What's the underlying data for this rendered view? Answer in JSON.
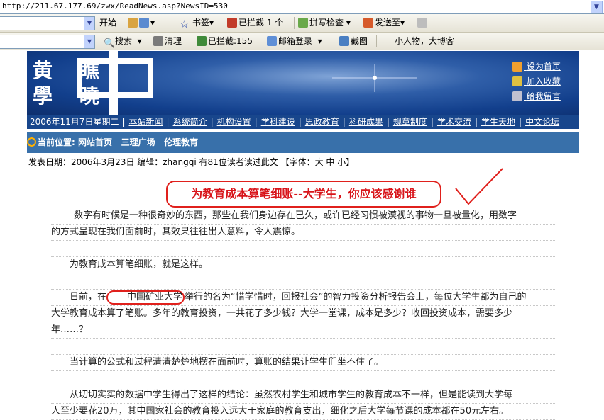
{
  "address": {
    "url": "http://211.67.177.69/zwx/ReadNews.asp?NewsID=530"
  },
  "toolbar1": {
    "start_label": "开始",
    "bookmarks_label": "书签",
    "blocked_label": "已拦截 1 个",
    "spellcheck_label": "拼写检查",
    "sendto_label": "发送至"
  },
  "toolbar2": {
    "search_label": "搜索",
    "clean_label": "清理",
    "blocked_label": "已拦截:155",
    "mail_label": "邮箱登录",
    "screenshot_label": "截图",
    "slogan": "小人物，大博客"
  },
  "banner": {
    "logo_line1": "黄 瞧",
    "logo_line2": "學 曉",
    "links": [
      "设为首页",
      "加入收藏",
      "给我留言"
    ]
  },
  "nav": {
    "date": "2006年11月7日星期二",
    "items": [
      "本站新闻",
      "系统简介",
      "机构设置",
      "学科建设",
      "思政教育",
      "科研成果",
      "规章制度",
      "学术交流",
      "学生天地",
      "中文论坛"
    ]
  },
  "breadcrumb": {
    "label": "当前位置:",
    "items": [
      "网站首页",
      "三理广场",
      "伦理教育"
    ]
  },
  "meta": {
    "text": "发表日期：2006年3月23日 编辑：zhangqi 有81位读者读过此文 【字体：大 中 小】"
  },
  "article": {
    "title": "为教育成本算笔细账--大学生，你应该感谢谁",
    "p1a": "数字有时候是一种很奇妙的东西，那些在我们身边存在已久，或许已经习惯被漠视的事物一旦被量化，用数字",
    "p1b": "的方式呈现在我们面前时，其效果往往出人意料，令人震惊。",
    "p2": "为教育成本算笔细账，就是这样。",
    "p3a_pre": "日前，在",
    "p3a_circ": "中国矿业大学",
    "p3a_post": "举行的名为“惜学惜时，回报社会”的智力投资分析报告会上，每位大学生都为自己的",
    "p3b": "大学教育成本算了笔账。多年的教育投资，一共花了多少钱？大学一堂课，成本是多少？收回投资成本，需要多少",
    "p3c": "年……？",
    "p4": "当计算的公式和过程清清楚楚地摆在面前时，算账的结果让学生们坐不住了。",
    "p5a": "从切切实实的数据中学生得出了这样的结论：虽然农村学生和城市学生的教育成本不一样，但是能读到大学每",
    "p5b": "人至少要花20万，其中国家社会的教育投入远大于家庭的教育支出，细化之后大学每节课的成本都在50元左右。"
  }
}
